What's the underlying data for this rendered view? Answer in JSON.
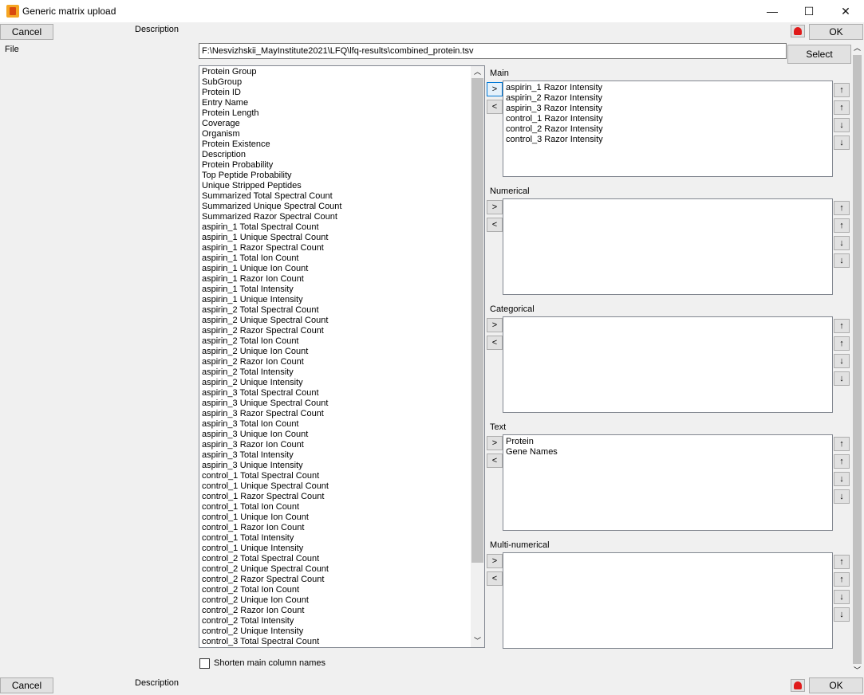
{
  "window": {
    "title": "Generic matrix upload"
  },
  "controls": {
    "minimize": "—",
    "maximize": "☐",
    "close": "✕"
  },
  "top": {
    "cancel": "Cancel",
    "description": "Description",
    "ok": "OK"
  },
  "bottom": {
    "cancel": "Cancel",
    "description": "Description",
    "ok": "OK"
  },
  "file": {
    "label": "File",
    "path": "F:\\Nesvizhskii_MayInstitute2021\\LFQ\\lfq-results\\combined_protein.tsv",
    "select": "Select"
  },
  "columns": [
    "Protein Group",
    "SubGroup",
    "Protein ID",
    "Entry Name",
    "Protein Length",
    "Coverage",
    "Organism",
    "Protein Existence",
    "Description",
    "Protein Probability",
    "Top Peptide Probability",
    "Unique Stripped Peptides",
    "Summarized Total Spectral Count",
    "Summarized Unique Spectral Count",
    "Summarized Razor Spectral Count",
    "aspirin_1 Total Spectral Count",
    "aspirin_1 Unique Spectral Count",
    "aspirin_1 Razor Spectral Count",
    "aspirin_1 Total Ion Count",
    "aspirin_1 Unique Ion Count",
    "aspirin_1 Razor Ion Count",
    "aspirin_1 Total Intensity",
    "aspirin_1 Unique Intensity",
    "aspirin_2 Total Spectral Count",
    "aspirin_2 Unique Spectral Count",
    "aspirin_2 Razor Spectral Count",
    "aspirin_2 Total Ion Count",
    "aspirin_2 Unique Ion Count",
    "aspirin_2 Razor Ion Count",
    "aspirin_2 Total Intensity",
    "aspirin_2 Unique Intensity",
    "aspirin_3 Total Spectral Count",
    "aspirin_3 Unique Spectral Count",
    "aspirin_3 Razor Spectral Count",
    "aspirin_3 Total Ion Count",
    "aspirin_3 Unique Ion Count",
    "aspirin_3 Razor Ion Count",
    "aspirin_3 Total Intensity",
    "aspirin_3 Unique Intensity",
    "control_1 Total Spectral Count",
    "control_1 Unique Spectral Count",
    "control_1 Razor Spectral Count",
    "control_1 Total Ion Count",
    "control_1 Unique Ion Count",
    "control_1 Razor Ion Count",
    "control_1 Total Intensity",
    "control_1 Unique Intensity",
    "control_2 Total Spectral Count",
    "control_2 Unique Spectral Count",
    "control_2 Razor Spectral Count",
    "control_2 Total Ion Count",
    "control_2 Unique Ion Count",
    "control_2 Razor Ion Count",
    "control_2 Total Intensity",
    "control_2 Unique Intensity",
    "control_3 Total Spectral Count"
  ],
  "sections": [
    {
      "label": "Main",
      "items": [
        "aspirin_1 Razor Intensity",
        "aspirin_2 Razor Intensity",
        "aspirin_3 Razor Intensity",
        "control_1 Razor Intensity",
        "control_2 Razor Intensity",
        "control_3 Razor Intensity"
      ]
    },
    {
      "label": "Numerical",
      "items": []
    },
    {
      "label": "Categorical",
      "items": []
    },
    {
      "label": "Text",
      "items": [
        "Protein",
        "Gene Names"
      ]
    },
    {
      "label": "Multi-numerical",
      "items": []
    }
  ],
  "section_buttons": {
    "add": ">",
    "remove": "<"
  },
  "order_buttons": {
    "top": "↑",
    "up": "↑",
    "down": "↓",
    "bottom": "↓"
  },
  "scroll_glyphs": {
    "up": "︿",
    "down": "﹀"
  },
  "shorten": {
    "label": "Shorten main column names"
  }
}
